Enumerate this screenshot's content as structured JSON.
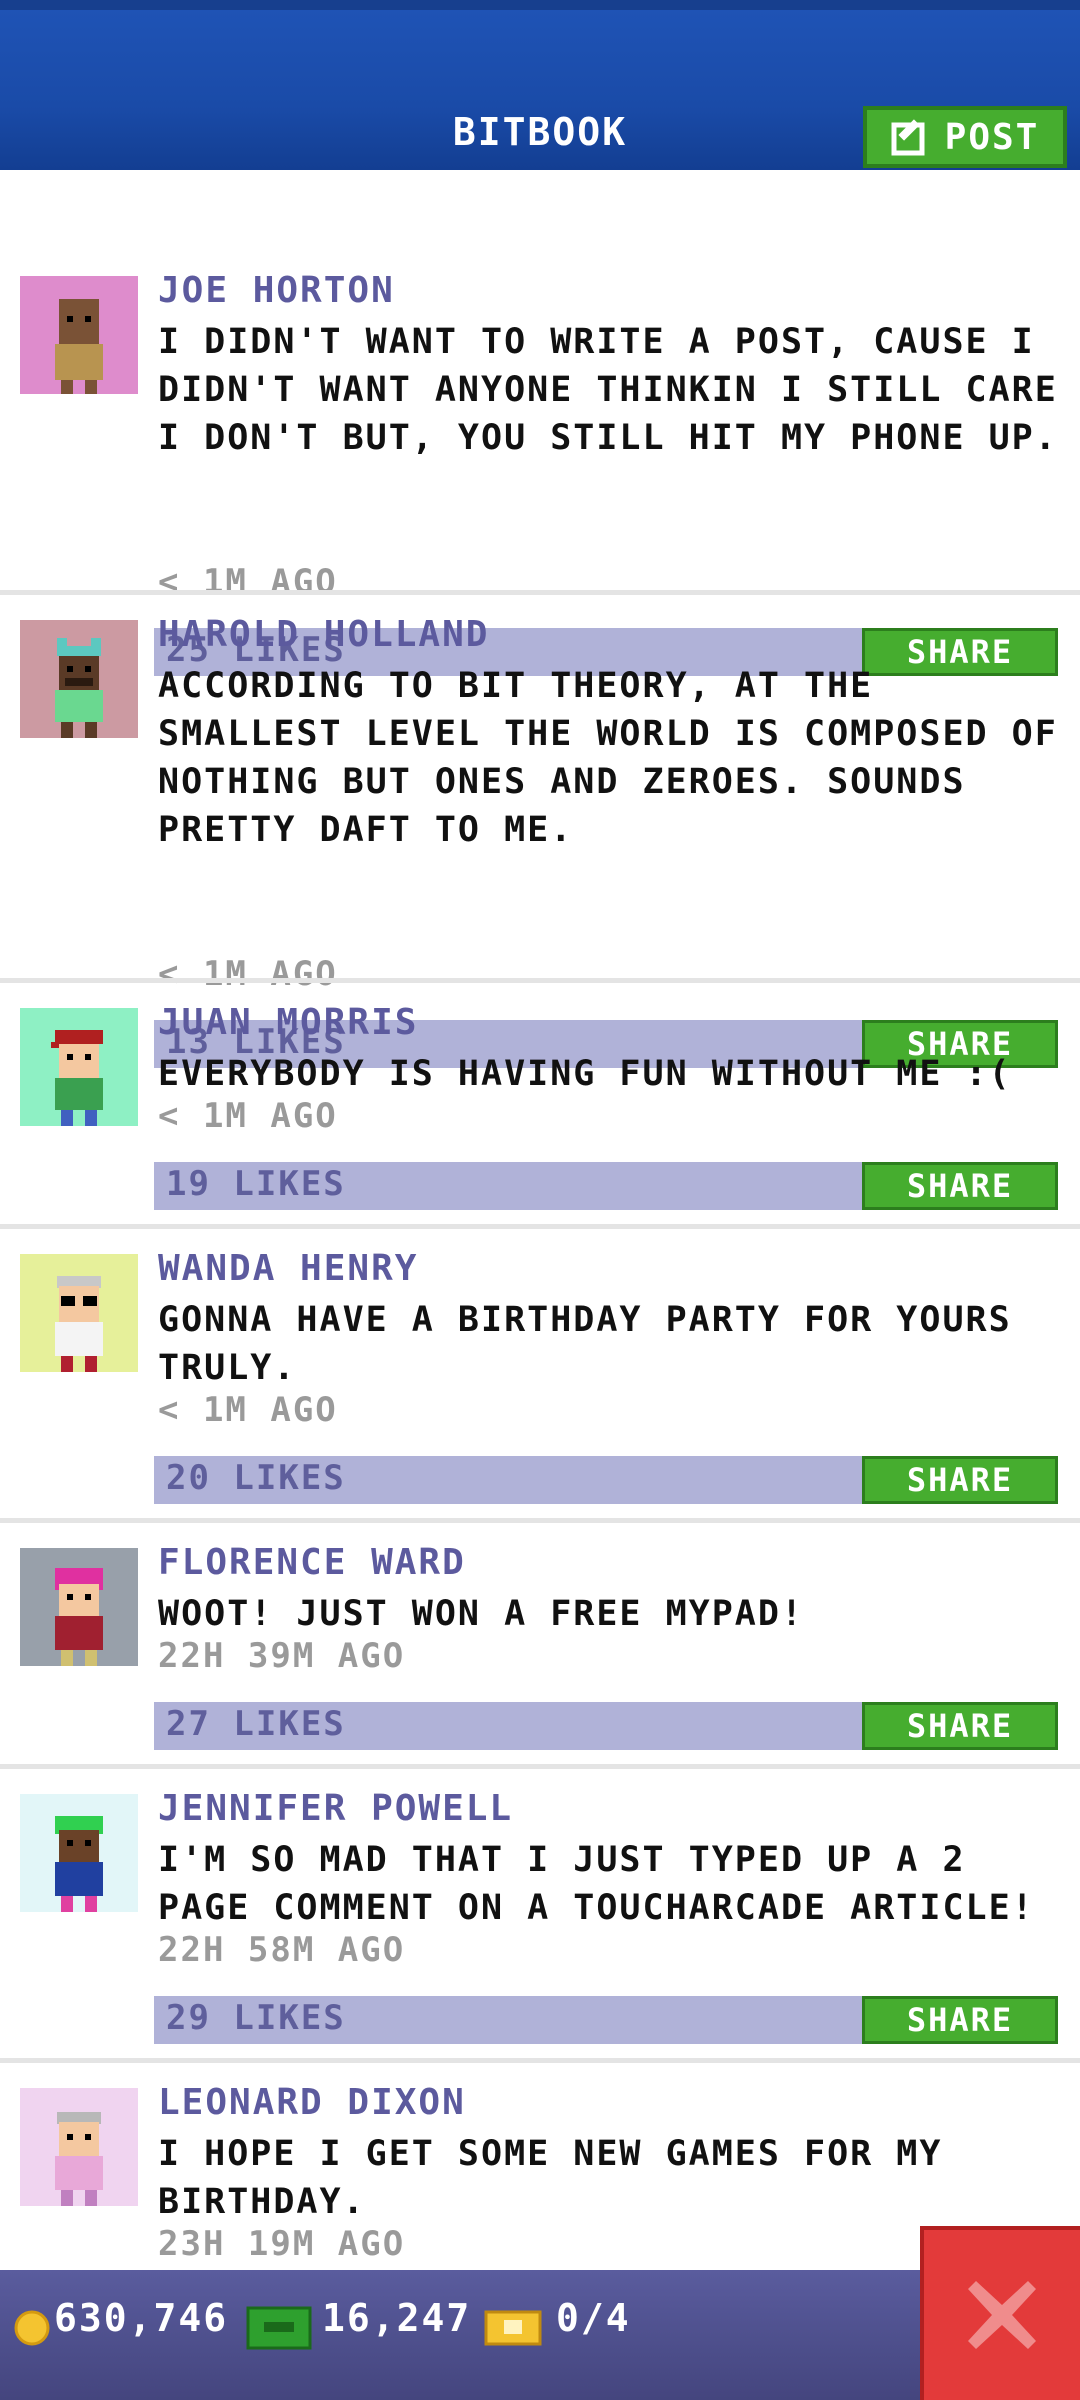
{
  "header": {
    "title": "BITBOOK",
    "post_label": "POST"
  },
  "posts": [
    {
      "author": "JOE HORTON",
      "text": "I DIDN'T WANT TO WRITE A POST, CAUSE I DIDN'T WANT ANYONE THINKIN I STILL CARE I DON'T BUT, YOU STILL HIT MY PHONE UP.",
      "time": "< 1M AGO",
      "likes": "25 LIKES",
      "share": "SHARE",
      "avatar_bg": "#de8ccc"
    },
    {
      "author": "HAROLD HOLLAND",
      "text": "ACCORDING TO BIT THEORY, AT THE SMALLEST LEVEL THE WORLD IS COMPOSED OF NOTHING BUT ONES AND ZEROES. SOUNDS PRETTY DAFT TO ME.",
      "time": "< 1M AGO",
      "likes": "13 LIKES",
      "share": "SHARE",
      "avatar_bg": "#cc9aa2"
    },
    {
      "author": "JUAN MORRIS",
      "text": "EVERYBODY IS HAVING FUN WITHOUT ME :(",
      "time": "< 1M AGO",
      "likes": "19 LIKES",
      "share": "SHARE",
      "avatar_bg": "#8ef0c4"
    },
    {
      "author": "WANDA HENRY",
      "text": "GONNA HAVE A BIRTHDAY PARTY FOR YOURS TRULY.",
      "time": "< 1M AGO",
      "likes": "20 LIKES",
      "share": "SHARE",
      "avatar_bg": "#e6f09a"
    },
    {
      "author": "FLORENCE WARD",
      "text": "WOOT! JUST WON A FREE MYPAD!",
      "time": "22H 39M AGO",
      "likes": "27 LIKES",
      "share": "SHARE",
      "avatar_bg": "#98a0aa"
    },
    {
      "author": "JENNIFER POWELL",
      "text": "I'M SO MAD THAT I JUST TYPED UP A 2 PAGE COMMENT ON A TOUCHARCADE ARTICLE!",
      "time": "22H 58M AGO",
      "likes": "29 LIKES",
      "share": "SHARE",
      "avatar_bg": "#e2f6f8"
    },
    {
      "author": "LEONARD DIXON",
      "text": "I HOPE I GET SOME NEW GAMES FOR MY BIRTHDAY.",
      "time": "23H 19M AGO",
      "likes": "",
      "share": "",
      "avatar_bg": "#f0d4f0"
    }
  ],
  "footer": {
    "coins": "630,746",
    "bux": "16,247",
    "tickets": "0/4"
  }
}
